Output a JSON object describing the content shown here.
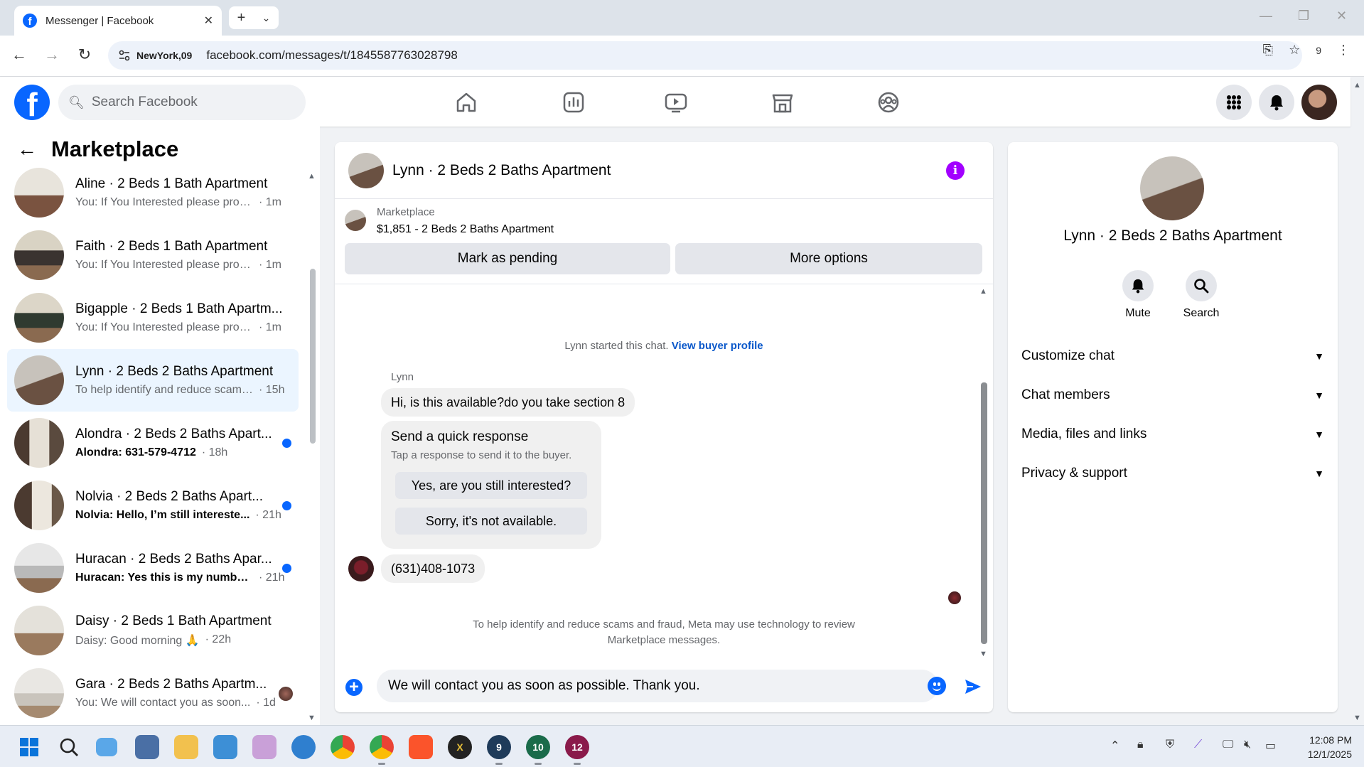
{
  "browser": {
    "tab_title": "Messenger | Facebook",
    "location_chip": "NewYork,09",
    "url": "facebook.com/messages/t/1845587763028798",
    "extensions_count": "9"
  },
  "fb_header": {
    "search_placeholder": "Search Facebook"
  },
  "sidebar": {
    "title": "Marketplace",
    "conversations": [
      {
        "name": "Aline · 2 Beds 1 Bath Apartment",
        "preview": "You: If You Interested please provi...",
        "time": "· 1m",
        "unread": false
      },
      {
        "name": "Faith · 2 Beds 1 Bath Apartment",
        "preview": "You: If You Interested please provi...",
        "time": "· 1m",
        "unread": false
      },
      {
        "name": "Bigapple · 2 Beds 1 Bath Apartm...",
        "preview": "You: If You Interested please provi...",
        "time": "· 1m",
        "unread": false
      },
      {
        "name": "Lynn · 2 Beds 2 Baths Apartment",
        "preview": "To help identify and reduce scams...",
        "time": "· 15h",
        "unread": false
      },
      {
        "name": "Alondra · 2 Beds 2 Baths Apart...",
        "preview": "Alondra: 631-579-4712",
        "time": "· 18h",
        "unread": true
      },
      {
        "name": "Nolvia · 2 Beds 2 Baths Apart...",
        "preview": "Nolvia: Hello, I’m still intereste...",
        "time": "· 21h",
        "unread": true
      },
      {
        "name": "Huracan · 2 Beds 2 Baths Apar...",
        "preview": "Huracan: Yes this is my number...",
        "time": "· 21h",
        "unread": true
      },
      {
        "name": "Daisy · 2 Beds 1 Bath Apartment",
        "preview": "Daisy: Good morning 🙏",
        "time": "· 22h",
        "unread": false
      },
      {
        "name": "Gara · 2 Beds 2 Baths Apartm...",
        "preview": "You: We will contact you as soon...",
        "time": "· 1d",
        "unread": false
      }
    ]
  },
  "chat": {
    "title": "Lynn · 2 Beds 2 Baths Apartment",
    "listing_source": "Marketplace",
    "listing_title": "$1,851 - 2 Beds 2 Baths Apartment",
    "mark_pending_label": "Mark as pending",
    "more_options_label": "More options",
    "started_text": "Lynn started this chat.",
    "view_profile_label": "View buyer profile",
    "sender_name": "Lynn",
    "message_1": "Hi, is this available?do you take section 8",
    "quick_response_title": "Send a quick response",
    "quick_response_sub": "Tap a response to send it to the buyer.",
    "quick_reply_1": "Yes, are you still interested?",
    "quick_reply_2": "Sorry, it's not available.",
    "message_2": "(631)408-1073",
    "notice_line1": "To help identify and reduce scams and fraud, Meta may use technology to review",
    "notice_line2": "Marketplace messages.",
    "composer_value": "We will contact you as soon as possible. Thank you."
  },
  "info_panel": {
    "name": "Lynn · 2 Beds 2 Baths Apartment",
    "mute_label": "Mute",
    "search_label": "Search",
    "sections": [
      "Customize chat",
      "Chat members",
      "Media, files and links",
      "Privacy & support"
    ]
  },
  "taskbar": {
    "time": "12:08 PM",
    "date": "12/1/2025",
    "badge_9": "9",
    "badge_10": "10",
    "badge_12": "12"
  },
  "colors": {
    "fb_blue": "#0866ff",
    "info_purple": "#a200ff",
    "active_row": "#ebf5ff"
  }
}
